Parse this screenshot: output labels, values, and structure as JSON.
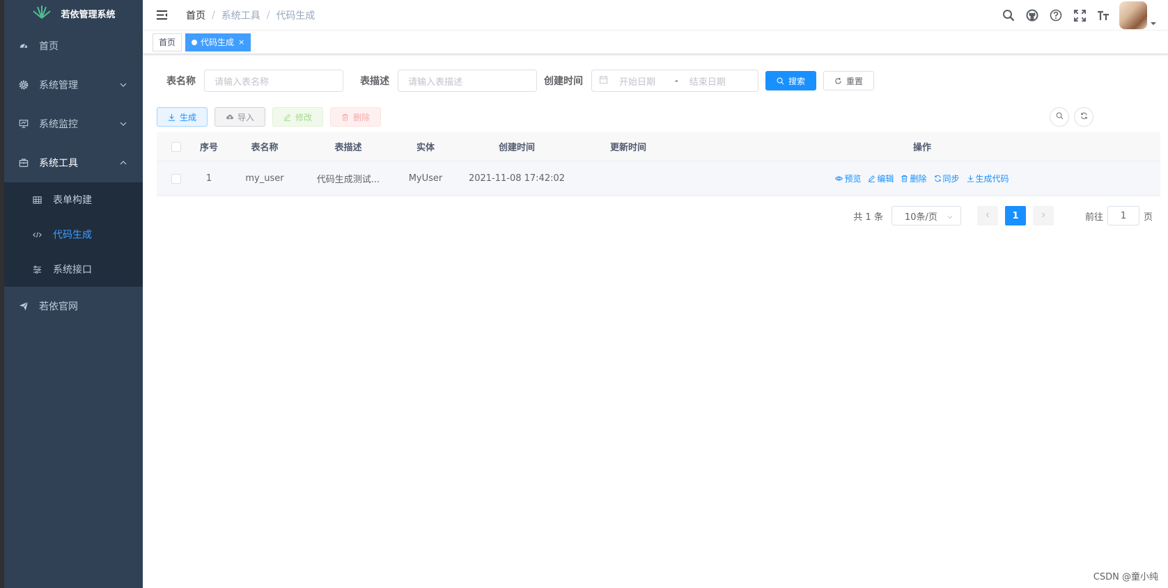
{
  "sidebar": {
    "logo_text": "若依管理系统",
    "items": [
      {
        "label": "首页",
        "icon": "dashboard-icon"
      },
      {
        "label": "系统管理",
        "icon": "gear-icon"
      },
      {
        "label": "系统监控",
        "icon": "monitor-icon"
      },
      {
        "label": "系统工具",
        "icon": "toolbox-icon"
      }
    ],
    "tool_sub": [
      {
        "label": "表单构建",
        "icon": "grid-icon"
      },
      {
        "label": "代码生成",
        "icon": "code-icon"
      },
      {
        "label": "系统接口",
        "icon": "sliders-icon"
      }
    ],
    "last_item": {
      "label": "若依官网",
      "icon": "send-icon"
    }
  },
  "navbar": {
    "breadcrumb": [
      "首页",
      "系统工具",
      "代码生成"
    ],
    "breadcrumb_sep": "/"
  },
  "tags": {
    "home": "首页",
    "active": "代码生成",
    "close": "×"
  },
  "search": {
    "table_name_label": "表名称",
    "table_name_placeholder": "请输入表名称",
    "table_desc_label": "表描述",
    "table_desc_placeholder": "请输入表描述",
    "create_time_label": "创建时间",
    "start_placeholder": "开始日期",
    "range_sep": "-",
    "end_placeholder": "结束日期",
    "search_btn": "搜索",
    "reset_btn": "重置"
  },
  "toolbar": {
    "generate": "生成",
    "import": "导入",
    "edit": "修改",
    "delete": "删除"
  },
  "table": {
    "headers": [
      "序号",
      "表名称",
      "表描述",
      "实体",
      "创建时间",
      "更新时间",
      "操作"
    ],
    "rows": [
      {
        "index": "1",
        "name": "my_user",
        "desc": "代码生成测试...",
        "entity": "MyUser",
        "create_time": "2021-11-08 17:42:02",
        "update_time": ""
      }
    ],
    "ops": [
      "预览",
      "编辑",
      "删除",
      "同步",
      "生成代码"
    ]
  },
  "pagination": {
    "total_text": "共 1 条",
    "page_size": "10条/页",
    "current_page": "1",
    "goto_label": "前往",
    "goto_value": "1",
    "page_unit": "页"
  },
  "watermark": "CSDN @童小纯",
  "colors": {
    "sidebar_bg": "#304156",
    "submenu_bg": "#1f2d3d",
    "primary": "#1890ff",
    "active_menu": "#409eff"
  }
}
